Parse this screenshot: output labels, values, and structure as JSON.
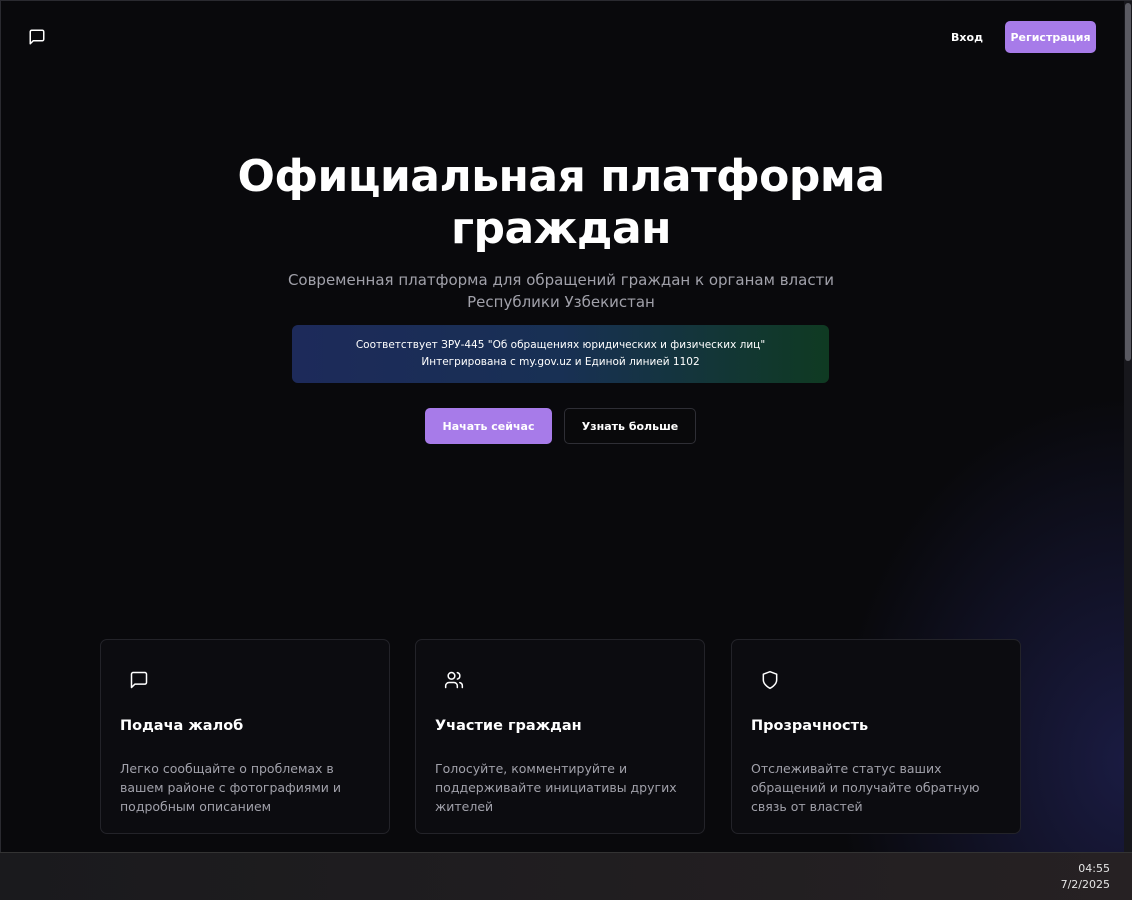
{
  "header": {
    "logo_icon": "message-square-icon",
    "login_label": "Вход",
    "register_label": "Регистрация"
  },
  "hero": {
    "title": "Официальная платформа граждан",
    "subtitle": "Современная платформа для обращений граждан к органам власти Республики Узбекистан",
    "banner_line1": "Соответствует ЗРУ-445 \"Об обращениях юридических и физических лиц\"",
    "banner_line2": "Интегрирована с my.gov.uz и Единой линией 1102",
    "start_label": "Начать сейчас",
    "learn_label": "Узнать больше"
  },
  "features": [
    {
      "icon": "message-square-icon",
      "title": "Подача жалоб",
      "description": "Легко сообщайте о проблемах в вашем районе с фотографиями и подробным описанием"
    },
    {
      "icon": "users-icon",
      "title": "Участие граждан",
      "description": "Голосуйте, комментируйте и поддерживайте инициативы других жителей"
    },
    {
      "icon": "shield-icon",
      "title": "Прозрачность",
      "description": "Отслеживайте статус ваших обращений и получайте обратную связь от властей"
    }
  ],
  "taskbar": {
    "time": "04:55",
    "date": "7/2/2025"
  },
  "colors": {
    "accent": "#a77be9",
    "background": "#09090c",
    "muted_text": "#a1a1aa"
  }
}
